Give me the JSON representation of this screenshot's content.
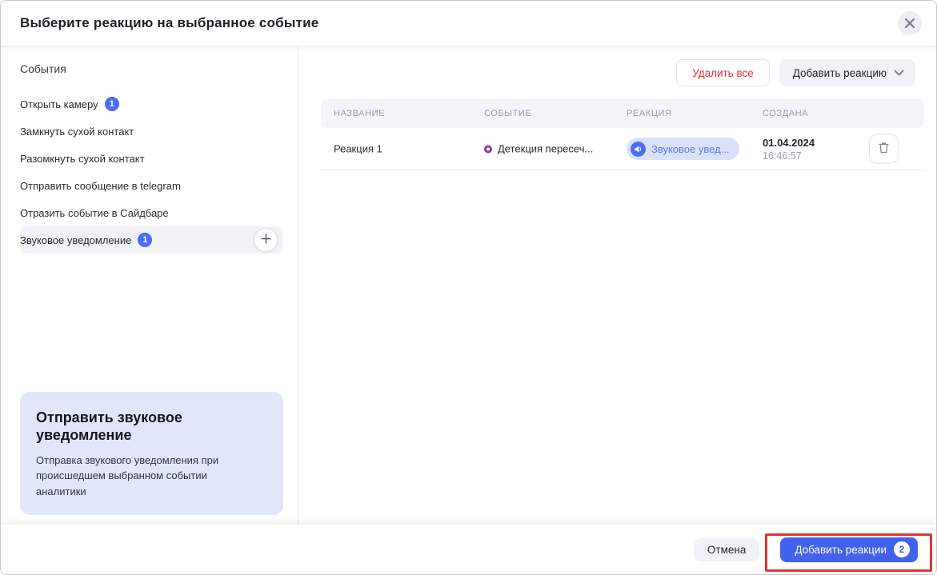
{
  "dialog": {
    "title": "Выберите реакцию на выбранное событие"
  },
  "sidebar": {
    "header": "События",
    "items": [
      {
        "label": "Открыть камеру",
        "badge": "1"
      },
      {
        "label": "Замкнуть сухой контакт"
      },
      {
        "label": "Разомкнуть сухой контакт"
      },
      {
        "label": "Отправить сообщение в telegram"
      },
      {
        "label": "Отразить событие в Сайдбаре"
      },
      {
        "label": "Звуковое уведомление",
        "badge": "1",
        "selected": true
      }
    ],
    "info_box": {
      "title": "Отправить звуковое уведомление",
      "description": "Отправка звукового уведомления при происшедшем выбранном событии аналитики"
    }
  },
  "toolbar": {
    "delete_all_label": "Удалить все",
    "add_reaction_label": "Добавить реакцию"
  },
  "table": {
    "headers": {
      "name": "НАЗВАНИЕ",
      "event": "СОБЫТИЕ",
      "reaction": "РЕАКЦИЯ",
      "created": "СОЗДАНА"
    },
    "rows": [
      {
        "name": "Реакция 1",
        "event": "Детекция пересеч...",
        "reaction": "Звуковое увед...",
        "created_date": "01.04.2024",
        "created_time": "16:46:57"
      }
    ]
  },
  "footer": {
    "cancel_label": "Отмена",
    "add_reactions_label": "Добавить реакции",
    "add_reactions_badge": "2"
  },
  "colors": {
    "accent_blue": "#4262ec",
    "badge_blue": "#4a6cf8",
    "pill_bg": "#dbe1fb",
    "pill_text": "#5b7bf2",
    "danger_red": "#e03131",
    "annotation_red": "#e23333",
    "info_box_bg": "#e2e6fb",
    "selected_item_bg": "#f1f2f8",
    "event_ring_purple": "#92398f"
  }
}
